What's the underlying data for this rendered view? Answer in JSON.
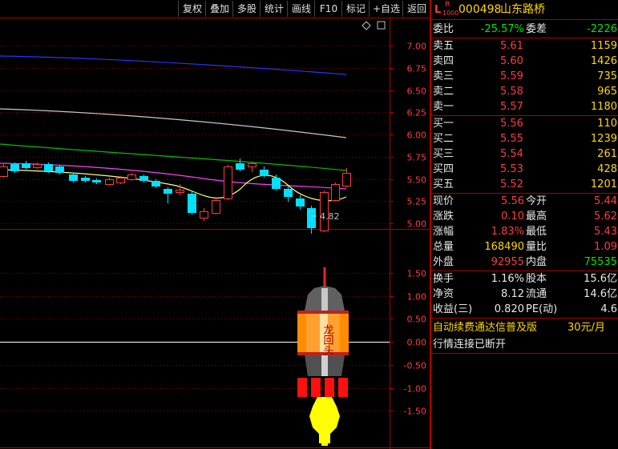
{
  "toolbar": {
    "buttons": [
      "复权",
      "叠加",
      "多股",
      "统计",
      "画线",
      "F10",
      "标记",
      "+自选",
      "返回"
    ]
  },
  "stock": {
    "prefix_l": "L",
    "prefix_r": "R",
    "prefix_sub": "1000",
    "code": "000498",
    "name": "山东路桥"
  },
  "commission": {
    "ratio_label": "委比",
    "ratio_value": "-25.57%",
    "diff_label": "委差",
    "diff_value": "-2226"
  },
  "asks": [
    {
      "label": "卖五",
      "price": "5.61",
      "volume": "1159"
    },
    {
      "label": "卖四",
      "price": "5.60",
      "volume": "1426"
    },
    {
      "label": "卖三",
      "price": "5.59",
      "volume": "735"
    },
    {
      "label": "卖二",
      "price": "5.58",
      "volume": "965"
    },
    {
      "label": "卖一",
      "price": "5.57",
      "volume": "1180"
    }
  ],
  "bids": [
    {
      "label": "买一",
      "price": "5.56",
      "volume": "110"
    },
    {
      "label": "买二",
      "price": "5.55",
      "volume": "1239"
    },
    {
      "label": "买三",
      "price": "5.54",
      "volume": "261"
    },
    {
      "label": "买四",
      "price": "5.53",
      "volume": "428"
    },
    {
      "label": "买五",
      "price": "5.52",
      "volume": "1201"
    }
  ],
  "stats": [
    {
      "l1": "现价",
      "v1": "5.56",
      "l2": "今开",
      "v2": "5.44"
    },
    {
      "l1": "涨跌",
      "v1": "0.10",
      "l2": "最高",
      "v2": "5.62"
    },
    {
      "l1": "涨幅",
      "v1": "1.83%",
      "l2": "最低",
      "v2": "5.43"
    },
    {
      "l1": "总量",
      "v1": "168490",
      "l2": "量比",
      "v2": "1.09"
    },
    {
      "l1": "外盘",
      "v1": "92955",
      "l2": "内盘",
      "v2": "75535"
    }
  ],
  "finance": [
    {
      "l1": "换手",
      "v1": "1.16%",
      "l2": "股本",
      "v2": "15.6亿"
    },
    {
      "l1": "净资",
      "v1": "8.12",
      "l2": "流通",
      "v2": "14.6亿"
    },
    {
      "l1": "收益(三)",
      "v1": "0.820",
      "l2": "PE(动)",
      "v2": "4.6"
    }
  ],
  "notice": {
    "ad": "自动续费通达信普及版",
    "price": "30元/月",
    "status": "行情连接已断开"
  },
  "price_axis": [
    "7.00",
    "6.75",
    "6.50",
    "6.25",
    "6.00",
    "5.75",
    "5.50",
    "5.25",
    "5.00"
  ],
  "indicator_axis": [
    "1.50",
    "1.00",
    "0.50",
    "0.00",
    "-0.50",
    "-1.00",
    "-1.50"
  ],
  "chart_annotation": {
    "low_marker": "4.82"
  },
  "rocket": {
    "text": "龙回头"
  },
  "colors": {
    "up": "#ff3b3b",
    "down": "#00e0ff",
    "ma_blue": "#3030ff",
    "ma_green": "#00c000",
    "ma_magenta": "#ff40ff",
    "ma_yellow": "#ffff80",
    "ma_white": "#e0e0e0",
    "panel_border": "#b00000"
  }
}
